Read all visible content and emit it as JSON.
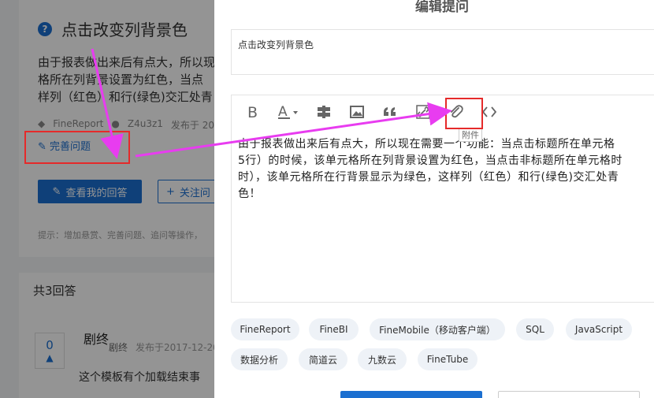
{
  "question": {
    "title": "点击改变列背景色",
    "body_lines": [
      "由于报表做出来后有点大，所以现",
      "格所在列背景设置为红色，当点",
      "样列（红色）和行(绿色)交汇处青"
    ],
    "meta_source": "FineReport",
    "meta_user": "Z4u3z1",
    "meta_time": "发布于 20",
    "improve_label": "完善问题",
    "view_answer_label": "查看我的回答",
    "follow_label": "关注问",
    "tip": "提示：增加悬赏、完善问题、追问等操作，"
  },
  "answers": {
    "count_label": "共3回答",
    "vote_count": "0",
    "user": "剧终",
    "time": "发布于2017-12-20",
    "text": "这个模板有个加载结束事",
    "signature": "剧终"
  },
  "modal": {
    "title": "编辑提问",
    "title_value": "点击改变列背景色",
    "content_lines": [
      "由于报表做出来后有点大，所以现在需要一个功能：当点击标题所在单元格",
      "5行）的时候，该单元格所在列背景设置为红色，当点击非标题所在单元格时",
      "时），该单元格所在行背景显示为绿色，这样列（红色）和行(绿色)交汇处青",
      "色！"
    ],
    "attachment_tooltip": "附件",
    "toolbar_icons": [
      "bold-icon",
      "font-color-icon",
      "divider-icon",
      "image-icon",
      "quote-icon",
      "link-icon",
      "attachment-icon",
      "code-icon"
    ],
    "tags": [
      "FineReport",
      "FineBI",
      "FineMobile（移动客户端）",
      "SQL",
      "JavaScript",
      "数据分析",
      "简道云",
      "九数云",
      "FineTube"
    ]
  },
  "colors": {
    "accent": "#1b6fd0",
    "highlight": "#e52a2a",
    "arrow": "#e83cf0",
    "tag_bg": "#eef2f7"
  }
}
